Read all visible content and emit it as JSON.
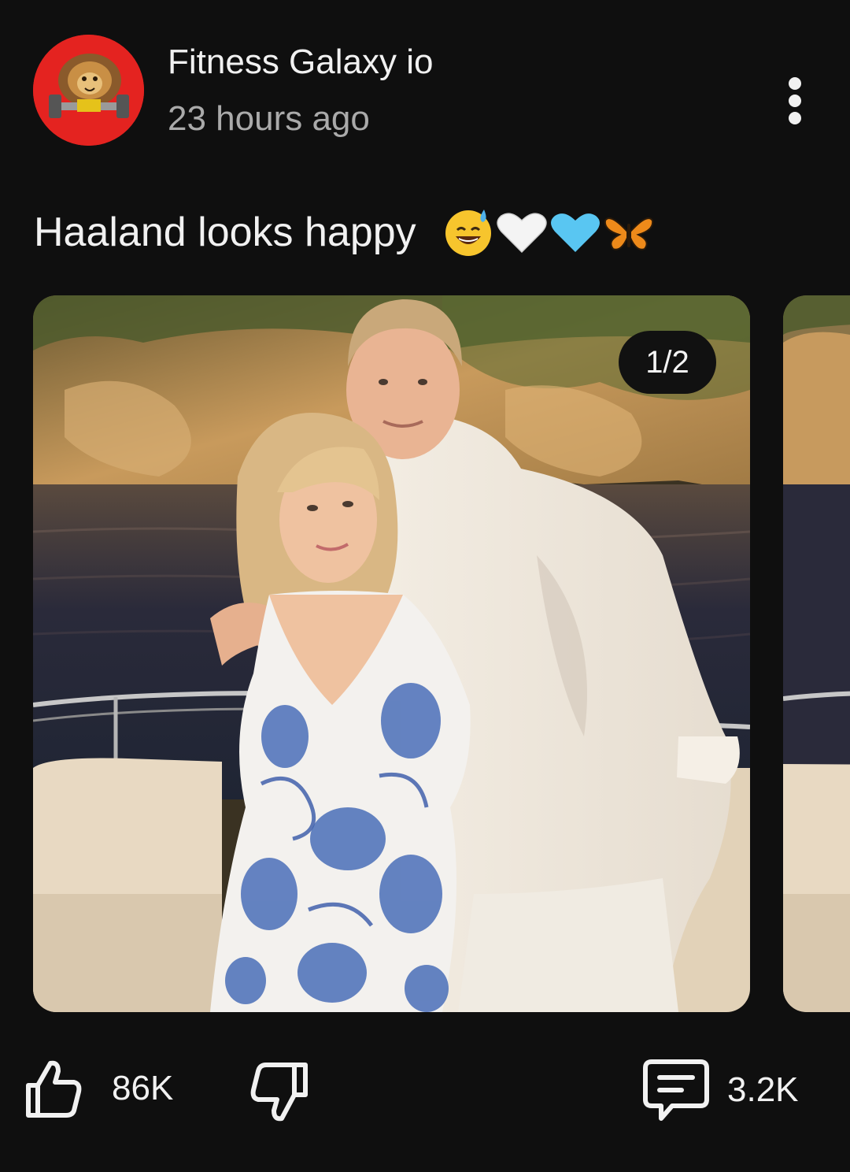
{
  "post": {
    "channel_name": "Fitness Galaxy io",
    "time": "23 hours ago",
    "text": "Haaland looks happy",
    "emojis": [
      "sweat-smile-emoji",
      "white-heart-emoji",
      "blue-heart-emoji",
      "butterfly-emoji"
    ]
  },
  "carousel": {
    "page_indicator": "1/2",
    "slides": [
      "photo-couple-on-boat",
      "photo-next-preview"
    ]
  },
  "actions": {
    "like_count": "86K",
    "comment_count": "3.2K",
    "icons": [
      "thumbs-up-icon",
      "thumbs-down-icon",
      "comment-icon",
      "more-vertical-icon"
    ]
  },
  "colors": {
    "background": "#0f0f0f",
    "text_primary": "#f1f1f1",
    "text_secondary": "#aaaaaa",
    "avatar_bg": "#e42320"
  }
}
